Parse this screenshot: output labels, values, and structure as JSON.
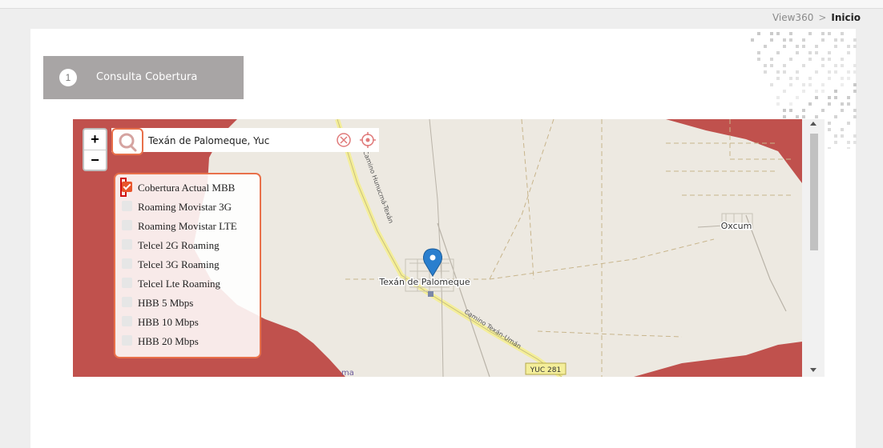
{
  "breadcrumb": {
    "root": "View360",
    "separator": ">",
    "current": "Inicio"
  },
  "step": {
    "number": "1",
    "label": "Consulta Cobertura"
  },
  "search": {
    "value": "Texán de Palomeque, Yuc"
  },
  "zoom": {
    "in": "+",
    "out": "−"
  },
  "layers": [
    {
      "label": "Cobertura Actual MBB",
      "checked": true
    },
    {
      "label": "Roaming Movistar 3G",
      "checked": false
    },
    {
      "label": "Roaming Movistar LTE",
      "checked": false
    },
    {
      "label": "Telcel 2G Roaming",
      "checked": false
    },
    {
      "label": "Telcel 3G Roaming",
      "checked": false
    },
    {
      "label": "Telcel Lte Roaming",
      "checked": false
    },
    {
      "label": "HBB 5 Mbps",
      "checked": false
    },
    {
      "label": "HBB 10 Mbps",
      "checked": false
    },
    {
      "label": "HBB 20 Mbps",
      "checked": false
    }
  ],
  "map_labels": {
    "town": "Texán de Palomeque",
    "village": "Oxcum",
    "road1": "Camino Hunucmá-Texán",
    "road2": "Camino Texán-Umán",
    "route": "YUC 281",
    "bottom": "ma"
  },
  "colors": {
    "coverage": "#c0514d",
    "accent": "#e8704a",
    "marker": "#2a7fce",
    "panel_step": "#a8a5a5"
  }
}
